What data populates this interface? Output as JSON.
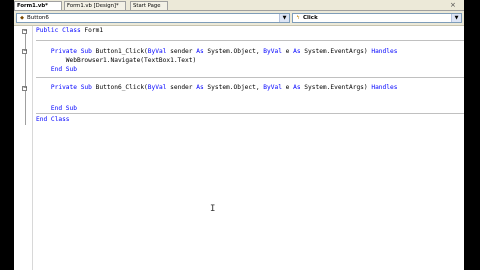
{
  "tabs": [
    {
      "label": "Form1.vb*",
      "active": true
    },
    {
      "label": "Form1.vb [Design]*",
      "active": false
    },
    {
      "label": "Start Page",
      "active": false
    }
  ],
  "close_glyph": "×",
  "dropdowns": {
    "object": {
      "value": "Button6",
      "icon": "class-icon"
    },
    "event": {
      "value": "Click",
      "icon": "event-lightning-icon"
    }
  },
  "code": {
    "line1": {
      "kw1": "Public Class",
      "rest": " Form1"
    },
    "line2": {
      "indent": "    ",
      "kw1": "Private Sub",
      "mid1": " Button1_Click(",
      "kw2": "ByVal",
      "mid2": " sender ",
      "kw3": "As",
      "mid3": " System.Object, ",
      "kw4": "ByVal",
      "mid4": " e ",
      "kw5": "As",
      "mid5": " System.EventArgs) ",
      "kw6": "Handles"
    },
    "line3": {
      "text": "        WebBrowser1.Navigate(TextBox1.Text)"
    },
    "line4": {
      "indent": "    ",
      "kw1": "End Sub"
    },
    "line5": {
      "indent": "    ",
      "kw1": "Private Sub",
      "mid1": " Button6_Click(",
      "kw2": "ByVal",
      "mid2": " sender ",
      "kw3": "As",
      "mid3": " System.Object, ",
      "kw4": "ByVal",
      "mid4": " e ",
      "kw5": "As",
      "mid5": " System.EventArgs) ",
      "kw6": "Handles"
    },
    "line6": {
      "indent": "    ",
      "kw1": "End Sub"
    },
    "line7": {
      "kw1": "End Class"
    }
  },
  "colors": {
    "keyword": "#0000ff",
    "text": "#000000",
    "letterbox": "#000000"
  }
}
